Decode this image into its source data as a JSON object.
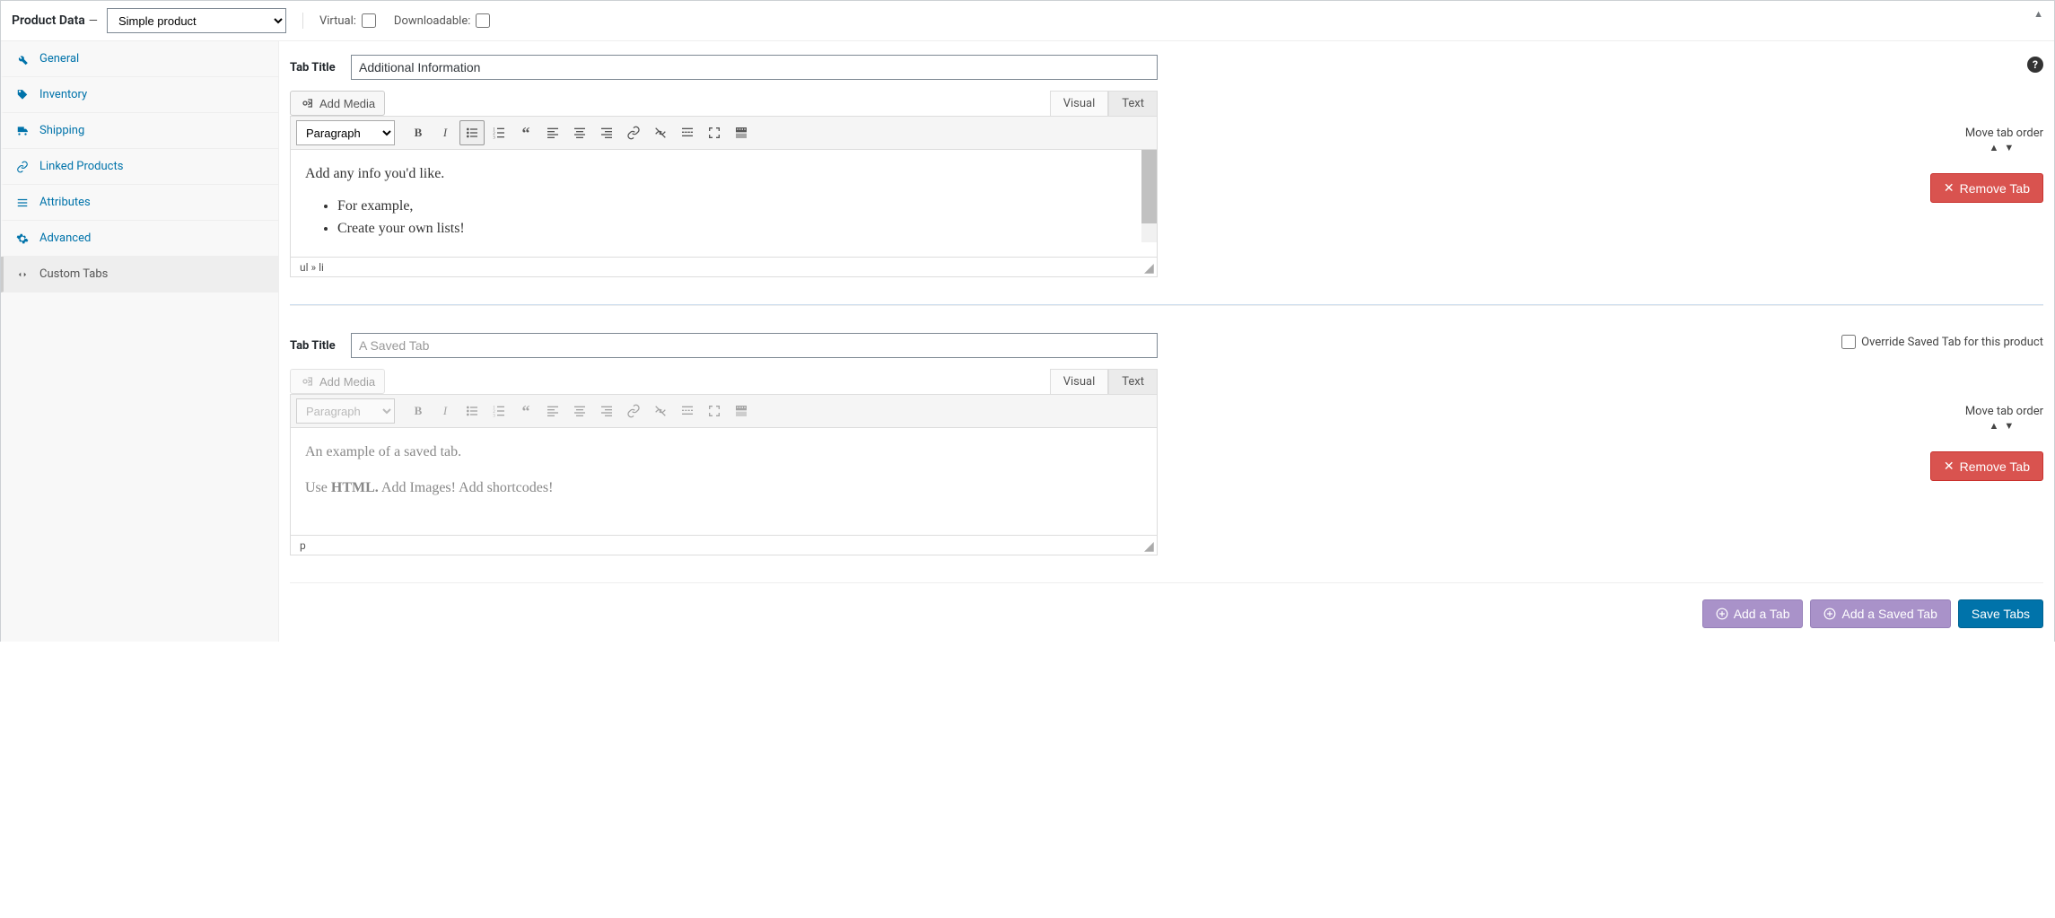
{
  "header": {
    "title": "Product Data",
    "dash": "—",
    "product_type": "Simple product",
    "virtual_label": "Virtual:",
    "downloadable_label": "Downloadable:"
  },
  "sidebar": {
    "items": [
      {
        "label": "General"
      },
      {
        "label": "Inventory"
      },
      {
        "label": "Shipping"
      },
      {
        "label": "Linked Products"
      },
      {
        "label": "Attributes"
      },
      {
        "label": "Advanced"
      },
      {
        "label": "Custom Tabs"
      }
    ]
  },
  "tabs": {
    "tab_title_label": "Tab Title",
    "add_media_label": "Add Media",
    "visual_label": "Visual",
    "text_label": "Text",
    "format_select": "Paragraph",
    "move_label": "Move tab order",
    "remove_label": "Remove Tab",
    "override_label": "Override Saved Tab for this product",
    "tab1": {
      "title": "Additional Information",
      "body_p": "Add any info you'd like.",
      "body_li1": "For example,",
      "body_li2": "Create your own lists!",
      "path": "ul » li"
    },
    "tab2": {
      "title": "A Saved Tab",
      "body_p1": "An example of a saved tab.",
      "body_p2_a": "Use ",
      "body_p2_b": "HTML.",
      "body_p2_c": " Add Images! Add shortcodes!",
      "path": "p"
    }
  },
  "footer": {
    "add_tab": "Add a Tab",
    "add_saved": "Add a Saved Tab",
    "save": "Save Tabs"
  }
}
